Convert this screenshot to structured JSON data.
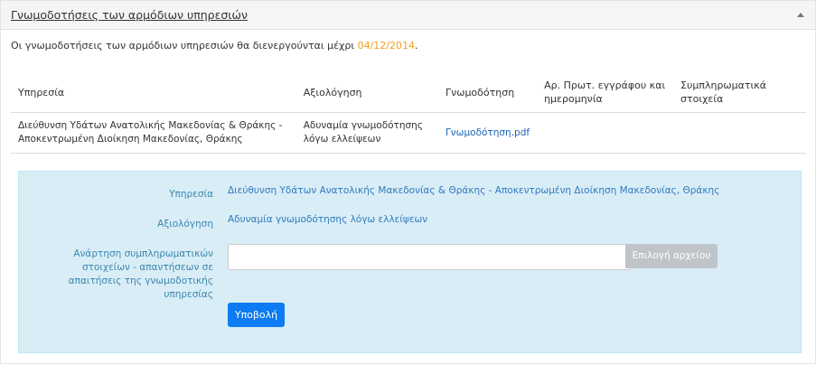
{
  "panel": {
    "title": "Γνωμοδοτήσεις των αρμόδιων υπηρεσιών",
    "collapse_icon": "chevron-up-icon"
  },
  "info": {
    "text": "Οι γνωμοδοτήσεις των αρμόδιων υπηρεσιών θα διενεργούνται μέχρι ",
    "date": "04/12/2014",
    "suffix": ".",
    "date_color": "#f0a020"
  },
  "table": {
    "headers": [
      "Υπηρεσία",
      "Αξιολόγηση",
      "Γνωμοδότηση",
      "Αρ. Πρωτ. εγγράφου και ημερομηνία",
      "Συμπληρωματικά στοιχεία"
    ],
    "rows": [
      {
        "service": "Διεύθυνση Υδάτων Ανατολικής Μακεδονίας & Θράκης - Αποκεντρωμένη Διοίκηση Μακεδονίας, Θράκης",
        "evaluation": "Αδυναμία γνωμοδότησης λόγω ελλείψεων",
        "opinion_link": "Γνωμοδότηση.pdf",
        "protocol": "",
        "supplementary": ""
      }
    ]
  },
  "form": {
    "service_label": "Υπηρεσία",
    "service_value": "Διεύθυνση Υδάτων Ανατολικής Μακεδονίας & Θράκης - Αποκεντρωμένη Διοίκηση Μακεδονίας, Θράκης",
    "evaluation_label": "Αξιολόγηση",
    "evaluation_value": "Αδυναμία γνωμοδότησης λόγω ελλείψεων",
    "upload_label": "Ανάρτηση συμπληρωματικών στοιχείων - απαντήσεων σε απαιτήσεις της γνωμοδοτικής υπηρεσίας",
    "file_input_value": "",
    "file_button": "Επιλογή αρχείου",
    "submit_button": "Υποβολή",
    "box_color": "#d9edf7",
    "submit_color": "#0d7bf2"
  }
}
